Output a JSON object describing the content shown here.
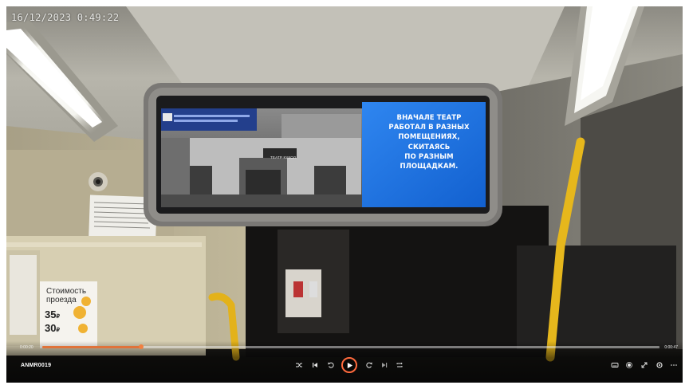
{
  "overlay": {
    "timestamp": "16/12/2023 0:49:22"
  },
  "bus_screen": {
    "ad_lines": [
      "ВНАЧАЛЕ ТЕАТР",
      "РАБОТАЛ В РАЗНЫХ",
      "ПОМЕЩЕНИЯХ,",
      "СКИТАЯСЬ",
      "ПО РАЗНЫМ",
      "ПЛОЩАДКАМ."
    ],
    "banner_lines": [
      "",
      ""
    ],
    "theatre_sign": "ТЕАТР КУКОЛ"
  },
  "fare_poster": {
    "title_lines": [
      "Стоимость",
      "проезда"
    ],
    "prices": [
      "35",
      "30"
    ],
    "currency": "₽"
  },
  "player": {
    "file_name": "ANMR0019",
    "time_current": "0:00:20",
    "time_total": "0:00:47",
    "progress": 0.16,
    "accent_color": "#e0733a",
    "left_controls": [
      "shuffle-icon",
      "skip-previous-icon",
      "replay-10-icon",
      "play-icon",
      "forward-10-icon",
      "skip-next-icon",
      "repeat-icon"
    ],
    "right_controls": [
      "subtitles-icon",
      "audio-icon",
      "fullscreen-icon",
      "settings-icon",
      "more-icon"
    ]
  },
  "colors": {
    "handrail": "#e3b21a",
    "screen_blue": "#1c6fe0",
    "ceiling": "#b9b7ad"
  }
}
